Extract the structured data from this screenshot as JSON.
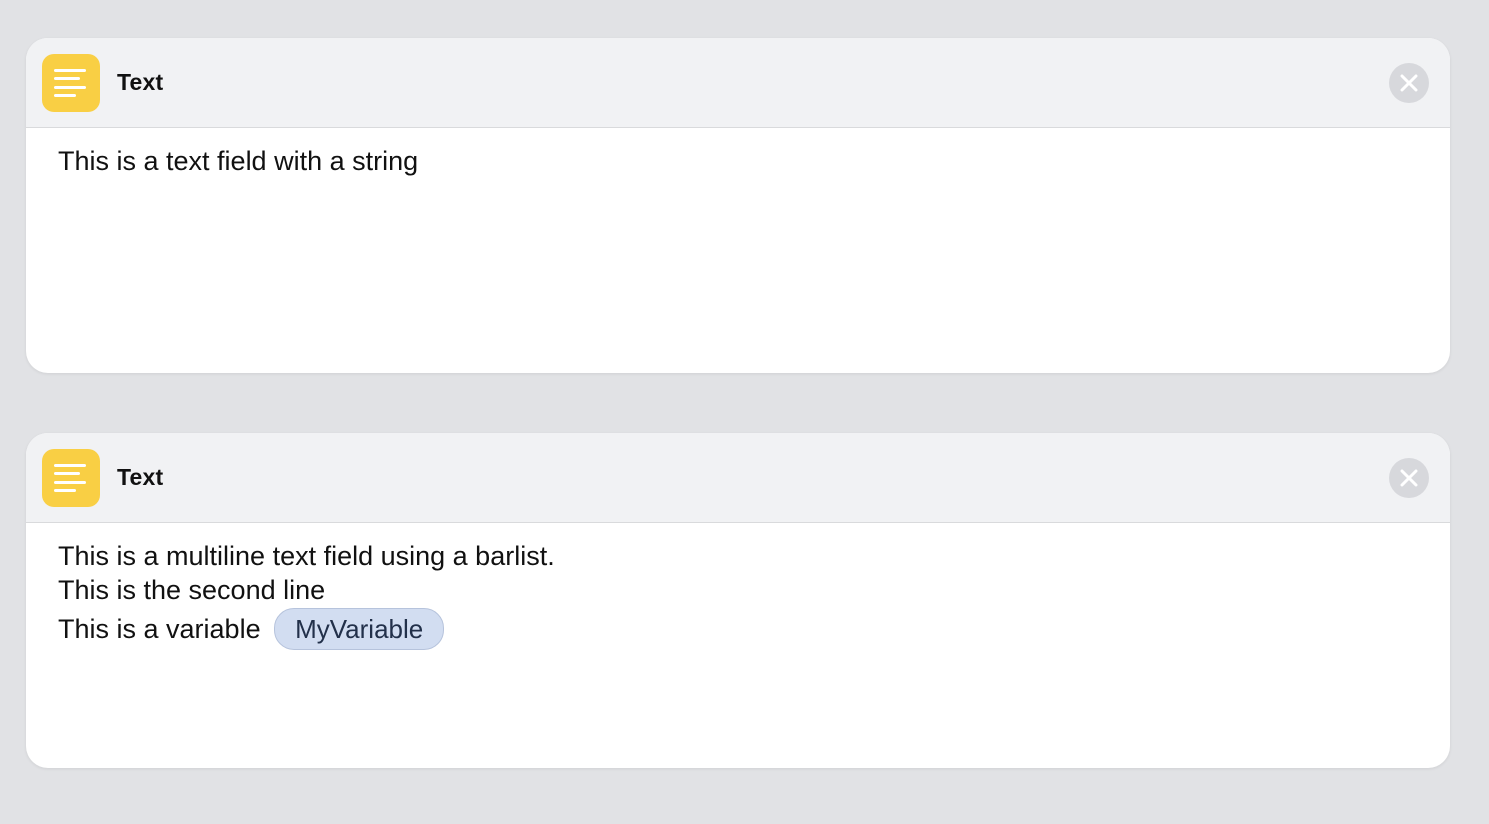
{
  "colors": {
    "background": "#e1e2e5",
    "card": "#ffffff",
    "header": "#f1f2f4",
    "app_icon": "#f9cf44",
    "close_button": "#d7d8dc",
    "variable_pill": "#d2ddf1"
  },
  "actions": [
    {
      "title": "Text",
      "icon": "text-lines-icon",
      "close_icon": "close-icon",
      "text": "This is a text field with a string"
    },
    {
      "title": "Text",
      "icon": "text-lines-icon",
      "close_icon": "close-icon",
      "lines": [
        "This is a multiline text field using a barlist.",
        "This is the second line"
      ],
      "variable_prefix": "This is a variable",
      "variable_name": "MyVariable"
    }
  ]
}
